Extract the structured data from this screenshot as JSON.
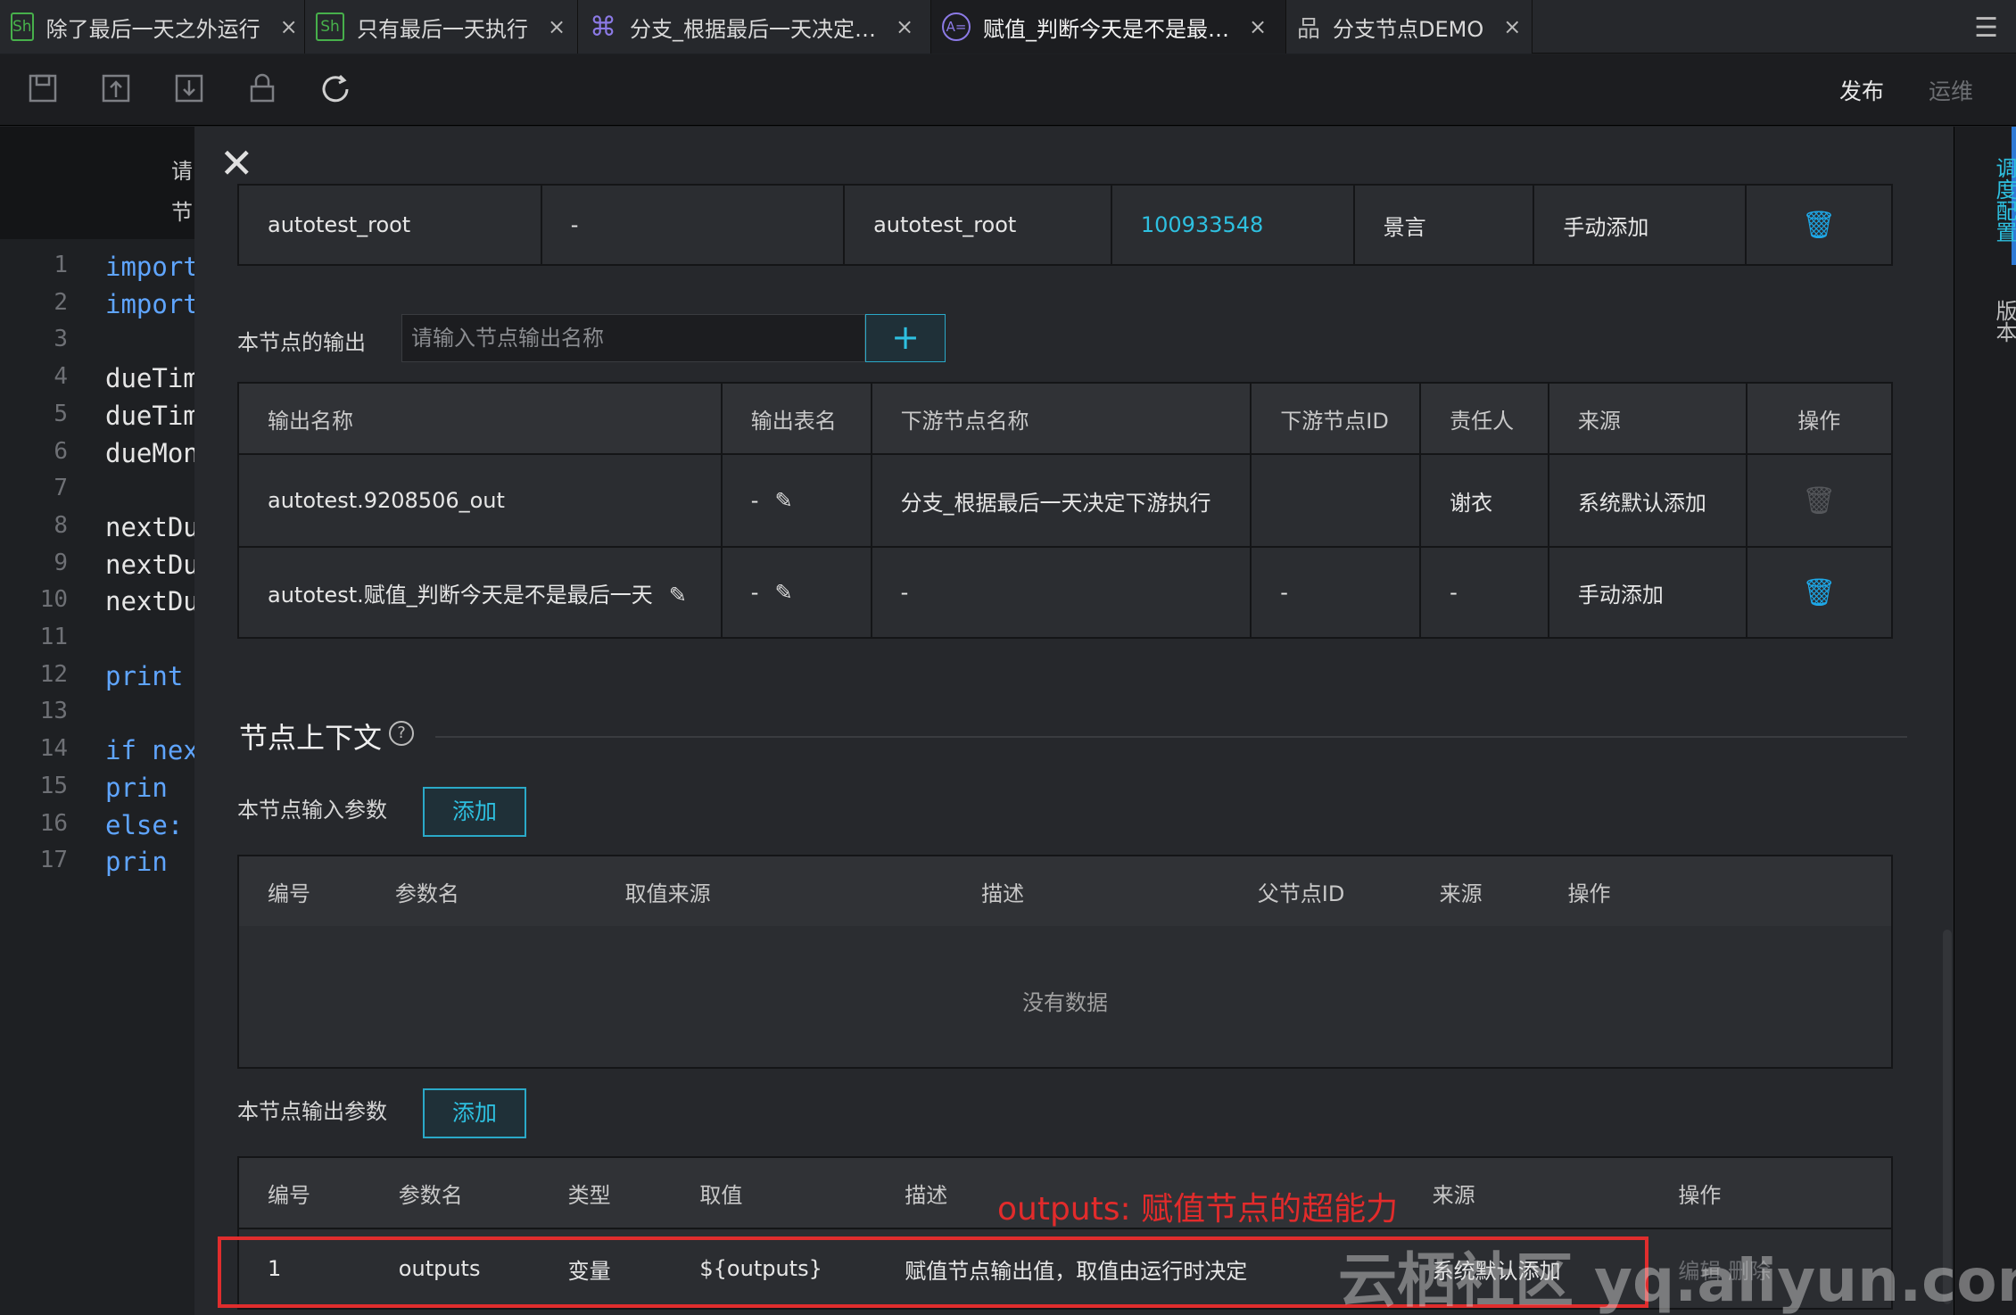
{
  "tabs": [
    {
      "label": "除了最后一天之外运行",
      "icon_text": "Sh"
    },
    {
      "label": "只有最后一天执行",
      "icon_text": "Sh"
    },
    {
      "label": "分支_根据最后一天决定…",
      "icon_text": "⌘"
    },
    {
      "label": "赋值_判断今天是不是最…",
      "icon_text": "A="
    },
    {
      "label": "分支节点DEMO",
      "icon_text": "品"
    }
  ],
  "tab_close": "×",
  "toolbar": {
    "publish": "发布",
    "ops": "运维"
  },
  "editor": {
    "hint1": "请",
    "hint2": "节",
    "lines": [
      {
        "no": "1",
        "text": "import",
        "kw": true
      },
      {
        "no": "2",
        "text": "import",
        "kw": true
      },
      {
        "no": "3",
        "text": "",
        "kw": false
      },
      {
        "no": "4",
        "text": "dueTim",
        "kw": false
      },
      {
        "no": "5",
        "text": "dueTim",
        "kw": false
      },
      {
        "no": "6",
        "text": "dueMon",
        "kw": false
      },
      {
        "no": "7",
        "text": "",
        "kw": false
      },
      {
        "no": "8",
        "text": "nextDu",
        "kw": false
      },
      {
        "no": "9",
        "text": "nextDu",
        "kw": false
      },
      {
        "no": "10",
        "text": "nextDu",
        "kw": false
      },
      {
        "no": "11",
        "text": "",
        "kw": false
      },
      {
        "no": "12",
        "text": "print",
        "kw": true
      },
      {
        "no": "13",
        "text": "",
        "kw": false
      },
      {
        "no": "14",
        "text": "if nex",
        "kw": true
      },
      {
        "no": "15",
        "text": "  prin",
        "kw": true
      },
      {
        "no": "16",
        "text": "else:",
        "kw": true
      },
      {
        "no": "17",
        "text": "  prin",
        "kw": true
      }
    ]
  },
  "sidebar": {
    "schedule": "调度配置",
    "version": "版本"
  },
  "input_table_row": {
    "c1": "autotest_root",
    "c2": "-",
    "c3": "autotest_root",
    "c4": "100933548",
    "c5": "景言",
    "c6": "手动添加"
  },
  "node_output": {
    "label": "本节点的输出",
    "placeholder": "请输入节点输出名称",
    "plus": "+"
  },
  "output_table": {
    "headers": [
      "输出名称",
      "输出表名",
      "下游节点名称",
      "下游节点ID",
      "责任人",
      "来源",
      "操作"
    ],
    "rows": [
      {
        "name": "autotest.9208506_out",
        "table": "-",
        "downstream": "分支_根据最后一天决定下游执行",
        "downstream_id": "",
        "owner": "谢衣",
        "source": "系统默认添加"
      },
      {
        "name": "autotest.赋值_判断今天是不是最后一天",
        "table": "-",
        "downstream": "-",
        "downstream_id": "-",
        "owner": "-",
        "source": "手动添加"
      }
    ]
  },
  "context": {
    "title": "节点上下文",
    "help": "?",
    "input_label": "本节点输入参数",
    "add_label": "添加",
    "input_headers": [
      "编号",
      "参数名",
      "取值来源",
      "描述",
      "父节点ID",
      "来源",
      "操作"
    ],
    "empty": "没有数据",
    "output_label": "本节点输出参数",
    "output_headers": [
      "编号",
      "参数名",
      "类型",
      "取值",
      "描述",
      "来源",
      "操作"
    ],
    "output_rows": [
      {
        "no": "1",
        "name": "outputs",
        "type": "变量",
        "value": "${outputs}",
        "desc": "赋值节点输出值，取值由运行时决定",
        "source": "系统默认添加",
        "actions": "编辑 删除"
      }
    ]
  },
  "annotation": "outputs: 赋值节点的超能力",
  "watermark": "云栖社区 yq.aliyun.com",
  "colors": {
    "accent": "#2ec0e0",
    "annotation": "#e02d2d",
    "panel": "#26282c"
  }
}
